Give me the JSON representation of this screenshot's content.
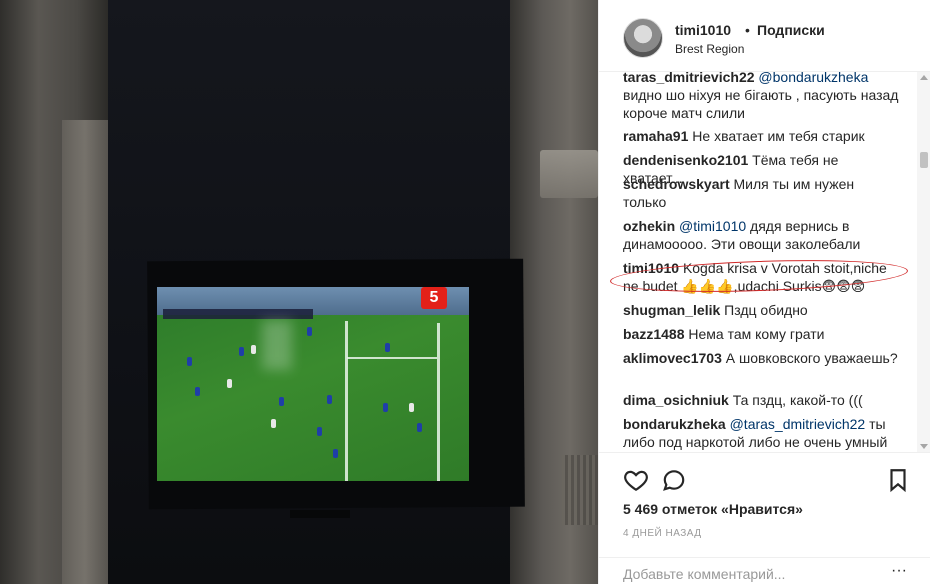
{
  "post": {
    "username": "timi1010",
    "separator": "•",
    "follow_label": "Подписки",
    "location": "Brest Region"
  },
  "tv": {
    "channel_logo": "5"
  },
  "comments": [
    {
      "user": "taras_dmitrievich22",
      "mention": "@bondarukzheka",
      "text": ""
    },
    {
      "user": "",
      "mention": "",
      "text": "видно шо ніхуя не бігають , пасують назад короче матч слили"
    },
    {
      "user": "ramaha91",
      "mention": "",
      "text": "Не хватает им тебя старик"
    },
    {
      "user": "dendenisenko2101",
      "mention": "",
      "text": "Тёма тебя не хватает..."
    },
    {
      "user": "schedrowskyart",
      "mention": "",
      "text": "Миля ты им нужен только"
    },
    {
      "user": "ozhekin",
      "mention": "@timi1010",
      "text": "дядя вернись в динамооооо. Эти овощи заколебали"
    },
    {
      "user": "timi1010",
      "mention": "",
      "text": "Kogda krisa v Vorotah stoit,niche ne budet 👍👍👍,udachi Surkis😨😨😨"
    },
    {
      "user": "shugman_lelik",
      "mention": "",
      "text": "Пздц обидно"
    },
    {
      "user": "bazz1488",
      "mention": "",
      "text": "Нема там кому грати"
    },
    {
      "user": "aklimovec1703",
      "mention": "",
      "text": "А шовковского уважаешь?"
    },
    {
      "user": "dima_osichniuk",
      "mention": "",
      "text": "Та пздц, какой-то ((("
    },
    {
      "user": "bondarukzheka",
      "mention": "@taras_dmitrievich22",
      "text": "ты либо под наркотой либо не очень умный"
    }
  ],
  "actions": {
    "likes": "5 469 отметок «Нравится»",
    "date": "4 ДНЕЙ НАЗАД",
    "comment_placeholder": "Добавьте комментарий...",
    "more": "···"
  },
  "icons": [
    "heart-icon",
    "comment-icon",
    "bookmark-icon",
    "more-icon"
  ],
  "colors": {
    "mention": "#003569",
    "highlight": "#d22b2b",
    "text": "#262626",
    "muted": "#999999"
  }
}
